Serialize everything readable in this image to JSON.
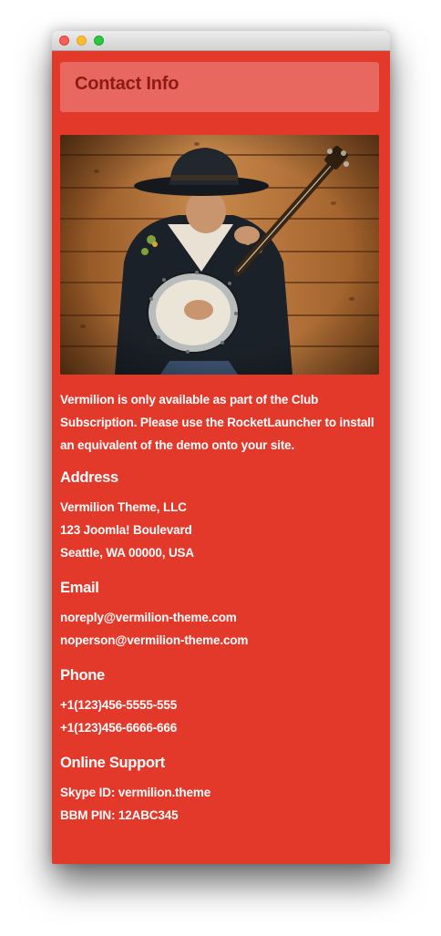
{
  "header": {
    "title": "Contact Info"
  },
  "photo": {
    "icon": "banjo-player-photo"
  },
  "intro": "Vermilion is only available as part of the Club Subscription. Please use the RocketLauncher to install an equivalent of the demo onto your site.",
  "sections": [
    {
      "title": "Address",
      "lines": [
        "Vermilion Theme, LLC",
        "123 Joomla! Boulevard",
        "Seattle, WA 00000, USA"
      ]
    },
    {
      "title": "Email",
      "lines": [
        "noreply@vermilion-theme.com",
        "noperson@vermilion-theme.com"
      ]
    },
    {
      "title": "Phone",
      "lines": [
        "+1(123)456-5555-555",
        "+1(123)456-6666-666"
      ]
    },
    {
      "title": "Online Support",
      "lines": [
        "Skype ID: vermilion.theme",
        "BBM PIN: 12ABC345"
      ]
    }
  ],
  "colors": {
    "background": "#e2392b",
    "header_box": "#e8675f",
    "header_text": "#8e1a14",
    "text": "#ffffff"
  }
}
